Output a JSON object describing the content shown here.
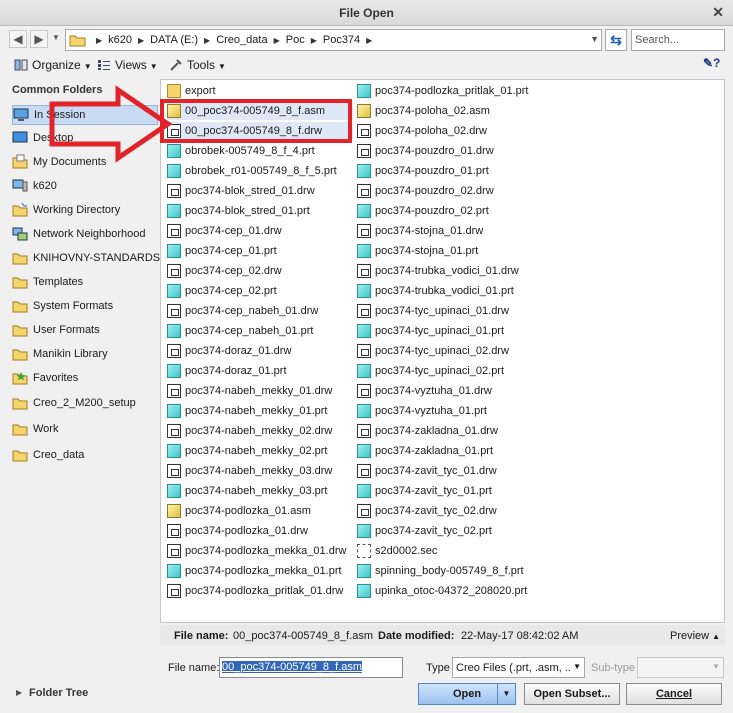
{
  "window": {
    "title": "File Open"
  },
  "nav": {
    "back": "◀",
    "forward": "▶",
    "breadcrumb": [
      "k620",
      "DATA (E:)",
      "Creo_data",
      "Poc",
      "Poc374"
    ],
    "search_placeholder": "Search..."
  },
  "toolbar": {
    "organize": "Organize",
    "views": "Views",
    "tools": "Tools"
  },
  "sidebar": {
    "header": "Common Folders",
    "items": [
      {
        "label": "In Session",
        "icon": "monitor-icon"
      },
      {
        "label": "Desktop",
        "icon": "desktop-icon"
      },
      {
        "label": "My Documents",
        "icon": "documents-icon"
      },
      {
        "label": "k620",
        "icon": "computer-icon"
      },
      {
        "label": "Working Directory",
        "icon": "working-dir-icon"
      },
      {
        "label": "Network Neighborhood",
        "icon": "network-icon"
      },
      {
        "label": "KNIHOVNY-STANDARDS",
        "icon": "folder-icon"
      },
      {
        "label": "Templates",
        "icon": "folder-icon"
      },
      {
        "label": "System Formats",
        "icon": "folder-icon"
      },
      {
        "label": "User Formats",
        "icon": "folder-icon"
      },
      {
        "label": "Manikin Library",
        "icon": "folder-icon"
      },
      {
        "label": "Favorites",
        "icon": "favorites-icon"
      },
      {
        "label": "Creo_2_M200_setup",
        "icon": "folder-icon"
      },
      {
        "label": "Work",
        "icon": "folder-icon"
      },
      {
        "label": "Creo_data",
        "icon": "folder-icon"
      }
    ],
    "folder_tree": "Folder Tree"
  },
  "files": {
    "col1": [
      {
        "name": "export",
        "type": "folder"
      },
      {
        "name": "00_poc374-005749_8_f.asm",
        "type": "asm"
      },
      {
        "name": "00_poc374-005749_8_f.drw",
        "type": "drw"
      },
      {
        "name": "obrobek-005749_8_f_4.prt",
        "type": "prt"
      },
      {
        "name": "obrobek_r01-005749_8_f_5.prt",
        "type": "prt"
      },
      {
        "name": "poc374-blok_stred_01.drw",
        "type": "drw"
      },
      {
        "name": "poc374-blok_stred_01.prt",
        "type": "prt"
      },
      {
        "name": "poc374-cep_01.drw",
        "type": "drw"
      },
      {
        "name": "poc374-cep_01.prt",
        "type": "prt"
      },
      {
        "name": "poc374-cep_02.drw",
        "type": "drw"
      },
      {
        "name": "poc374-cep_02.prt",
        "type": "prt"
      },
      {
        "name": "poc374-cep_nabeh_01.drw",
        "type": "drw"
      },
      {
        "name": "poc374-cep_nabeh_01.prt",
        "type": "prt"
      },
      {
        "name": "poc374-doraz_01.drw",
        "type": "drw"
      },
      {
        "name": "poc374-doraz_01.prt",
        "type": "prt"
      },
      {
        "name": "poc374-nabeh_mekky_01.drw",
        "type": "drw"
      },
      {
        "name": "poc374-nabeh_mekky_01.prt",
        "type": "prt"
      },
      {
        "name": "poc374-nabeh_mekky_02.drw",
        "type": "drw"
      },
      {
        "name": "poc374-nabeh_mekky_02.prt",
        "type": "prt"
      },
      {
        "name": "poc374-nabeh_mekky_03.drw",
        "type": "drw"
      },
      {
        "name": "poc374-nabeh_mekky_03.prt",
        "type": "prt"
      },
      {
        "name": "poc374-podlozka_01.asm",
        "type": "asm"
      },
      {
        "name": "poc374-podlozka_01.drw",
        "type": "drw"
      },
      {
        "name": "poc374-podlozka_mekka_01.drw",
        "type": "drw"
      },
      {
        "name": "poc374-podlozka_mekka_01.prt",
        "type": "prt"
      },
      {
        "name": "poc374-podlozka_pritlak_01.drw",
        "type": "drw"
      }
    ],
    "col2": [
      {
        "name": "poc374-podlozka_pritlak_01.prt",
        "type": "prt"
      },
      {
        "name": "poc374-poloha_02.asm",
        "type": "asm"
      },
      {
        "name": "poc374-poloha_02.drw",
        "type": "drw"
      },
      {
        "name": "poc374-pouzdro_01.drw",
        "type": "drw"
      },
      {
        "name": "poc374-pouzdro_01.prt",
        "type": "prt"
      },
      {
        "name": "poc374-pouzdro_02.drw",
        "type": "drw"
      },
      {
        "name": "poc374-pouzdro_02.prt",
        "type": "prt"
      },
      {
        "name": "poc374-stojna_01.drw",
        "type": "drw"
      },
      {
        "name": "poc374-stojna_01.prt",
        "type": "prt"
      },
      {
        "name": "poc374-trubka_vodici_01.drw",
        "type": "drw"
      },
      {
        "name": "poc374-trubka_vodici_01.prt",
        "type": "prt"
      },
      {
        "name": "poc374-tyc_upinaci_01.drw",
        "type": "drw"
      },
      {
        "name": "poc374-tyc_upinaci_01.prt",
        "type": "prt"
      },
      {
        "name": "poc374-tyc_upinaci_02.drw",
        "type": "drw"
      },
      {
        "name": "poc374-tyc_upinaci_02.prt",
        "type": "prt"
      },
      {
        "name": "poc374-vyztuha_01.drw",
        "type": "drw"
      },
      {
        "name": "poc374-vyztuha_01.prt",
        "type": "prt"
      },
      {
        "name": "poc374-zakladna_01.drw",
        "type": "drw"
      },
      {
        "name": "poc374-zakladna_01.prt",
        "type": "prt"
      },
      {
        "name": "poc374-zavit_tyc_01.drw",
        "type": "drw"
      },
      {
        "name": "poc374-zavit_tyc_01.prt",
        "type": "prt"
      },
      {
        "name": "poc374-zavit_tyc_02.drw",
        "type": "drw"
      },
      {
        "name": "poc374-zavit_tyc_02.prt",
        "type": "prt"
      },
      {
        "name": "s2d0002.sec",
        "type": "sec"
      },
      {
        "name": "spinning_body-005749_8_f.prt",
        "type": "prt"
      },
      {
        "name": "upinka_otoc-04372_208020.prt",
        "type": "prt"
      }
    ]
  },
  "status": {
    "file_name_label": "File name:",
    "file_name_value": "00_poc374-005749_8_f.asm",
    "date_label": "Date modified:",
    "date_value": "22-May-17 08:42:02 AM",
    "preview": "Preview"
  },
  "form": {
    "file_name_label": "File name:",
    "file_name_value": "00_poc374-005749_8_f.asm",
    "type_label": "Type",
    "type_value": "Creo Files (.prt, .asm, ..",
    "subtype_label": "Sub-type",
    "open": "Open",
    "open_subset": "Open Subset...",
    "cancel": "Cancel"
  },
  "colors": {
    "annotation_red": "#e0242a",
    "selection": "#dfe8f6"
  }
}
